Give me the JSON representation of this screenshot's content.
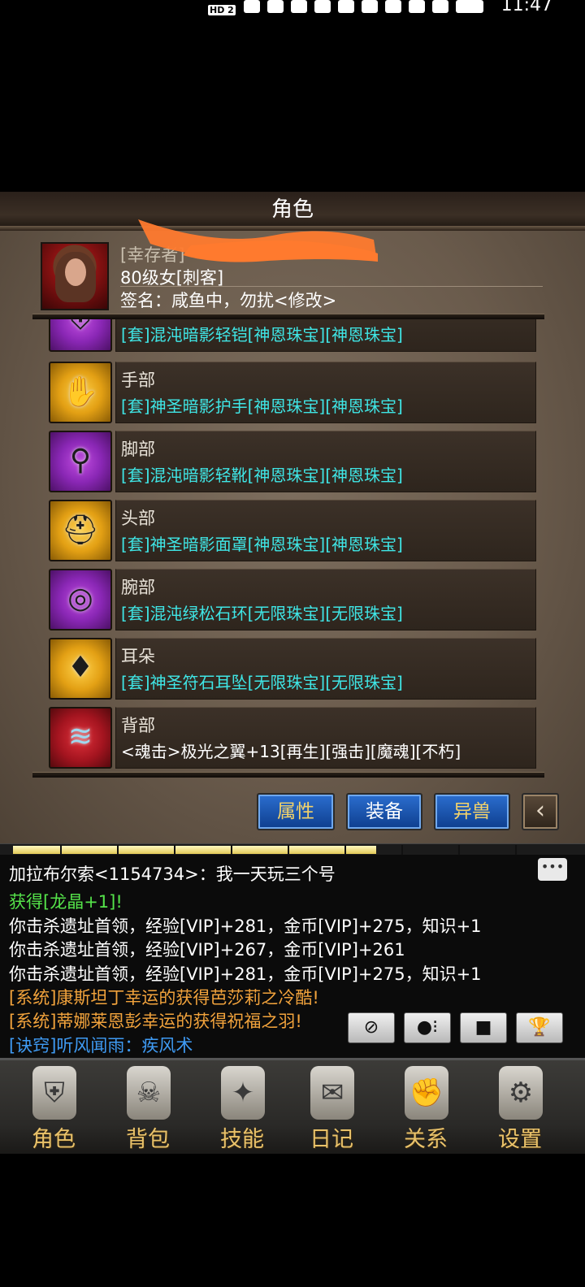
{
  "status_bar": {
    "hd": "HD 2",
    "time": "11:47"
  },
  "title": "角色",
  "profile": {
    "name": "[幸存者]",
    "level_class": "80级女[刺客]",
    "signature": "签名：咸鱼中，勿扰<修改>"
  },
  "equipment": [
    {
      "slot": "",
      "item": "[套]混沌暗影轻铠[神恩珠宝][神恩珠宝]",
      "frame": "purple",
      "icon": "armor-icon"
    },
    {
      "slot": "手部",
      "item": "[套]神圣暗影护手[神恩珠宝][神恩珠宝]",
      "frame": "gold",
      "icon": "gauntlet-icon"
    },
    {
      "slot": "脚部",
      "item": "[套]混沌暗影轻靴[神恩珠宝][神恩珠宝]",
      "frame": "purple",
      "icon": "boots-icon"
    },
    {
      "slot": "头部",
      "item": "[套]神圣暗影面罩[神恩珠宝][神恩珠宝]",
      "frame": "gold",
      "icon": "helmet-icon"
    },
    {
      "slot": "腕部",
      "item": "[套]混沌绿松石环[无限珠宝][无限珠宝]",
      "frame": "purple",
      "icon": "bracelet-icon"
    },
    {
      "slot": "耳朵",
      "item": "[套]神圣符石耳坠[无限珠宝][无限珠宝]",
      "frame": "gold",
      "icon": "earring-icon"
    },
    {
      "slot": "背部",
      "item": "<魂击>极光之翼+13[再生][强击][魔魂][不朽]",
      "frame": "red",
      "icon": "wings-icon"
    }
  ],
  "buttons": {
    "attributes": "属性",
    "equipment": "装备",
    "pet": "异兽",
    "back": "‹"
  },
  "exp_progress": 0.65,
  "chat": [
    {
      "text": "加拉布尔索<1154734>：我一天玩三个号",
      "color": "white"
    },
    {
      "text": "获得[龙晶+1]!",
      "color": "green"
    },
    {
      "text": "你击杀遗址首领，经验[VIP]+281，金币[VIP]+275，知识+1",
      "color": "white"
    },
    {
      "text": "你击杀遗址首领，经验[VIP]+267，金币[VIP]+261",
      "color": "white"
    },
    {
      "text": "你击杀遗址首领，经验[VIP]+281，金币[VIP]+275，知识+1",
      "color": "white"
    },
    {
      "text": "[系统]康斯坦丁幸运的获得芭莎莉之冷酷!",
      "color": "orange"
    },
    {
      "text": "[系统]蒂娜莱恩彭幸运的获得祝福之羽!",
      "color": "orange"
    },
    {
      "text": "[诀窍]听风闻雨：疾风术",
      "color": "blue"
    }
  ],
  "quick_buttons": [
    "compass-icon",
    "dots-icon",
    "stop-icon",
    "trophy-icon"
  ],
  "nav": [
    {
      "label": "角色",
      "icon": "helmet-icon"
    },
    {
      "label": "背包",
      "icon": "backpack-icon"
    },
    {
      "label": "技能",
      "icon": "spellbook-icon"
    },
    {
      "label": "日记",
      "icon": "scroll-icon"
    },
    {
      "label": "关系",
      "icon": "handshake-icon"
    },
    {
      "label": "设置",
      "icon": "gear-icon"
    }
  ]
}
